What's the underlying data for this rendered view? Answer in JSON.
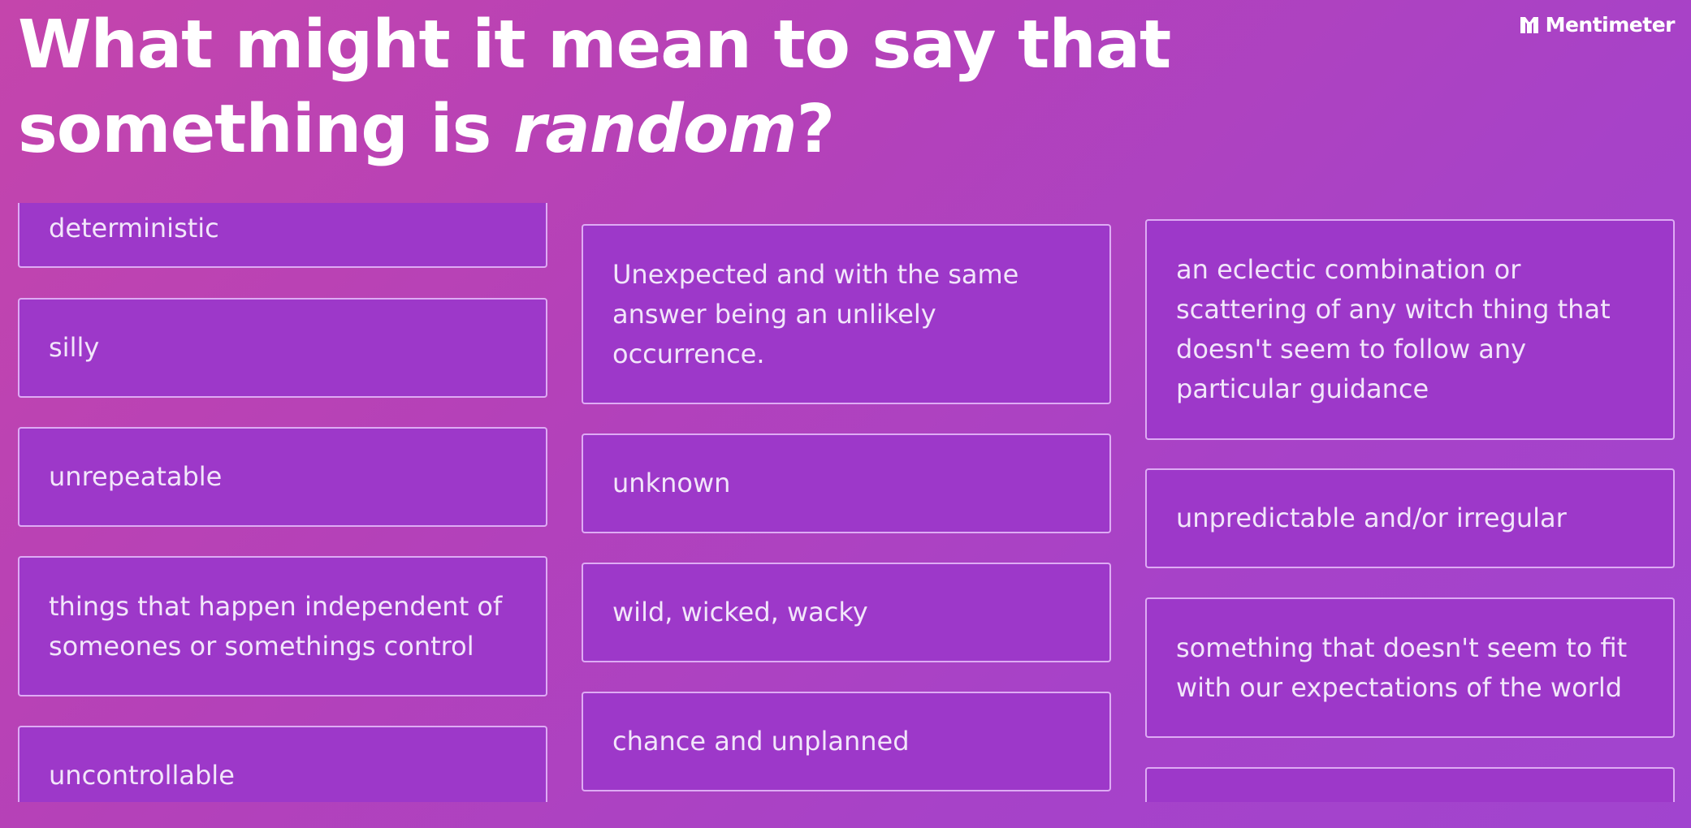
{
  "title": {
    "main": "What might it mean to say that something is ",
    "emphasis": "random",
    "suffix": "?"
  },
  "brand": {
    "name": "Mentimeter",
    "icon": "mentimeter-logo-icon"
  },
  "theme": {
    "background": "#b542b8",
    "card_fill": "#9d38c9",
    "card_border": "#e2b1f7",
    "text": "#ffffff"
  },
  "responses": {
    "column_1": [
      "deterministic",
      "silly",
      "unrepeatable",
      "things that happen independent of someones or somethings control",
      "uncontrollable"
    ],
    "column_2": [
      "Unexpected and with the same answer being an unlikely occurrence.",
      "unknown",
      "wild, wicked, wacky",
      "chance and unplanned"
    ],
    "column_3": [
      "an eclectic combination or scattering of any witch thing that doesn't seem to follow any particular guidance",
      "unpredictable and/or irregular",
      "something that doesn't seem to fit with our expectations of the world",
      ""
    ]
  }
}
